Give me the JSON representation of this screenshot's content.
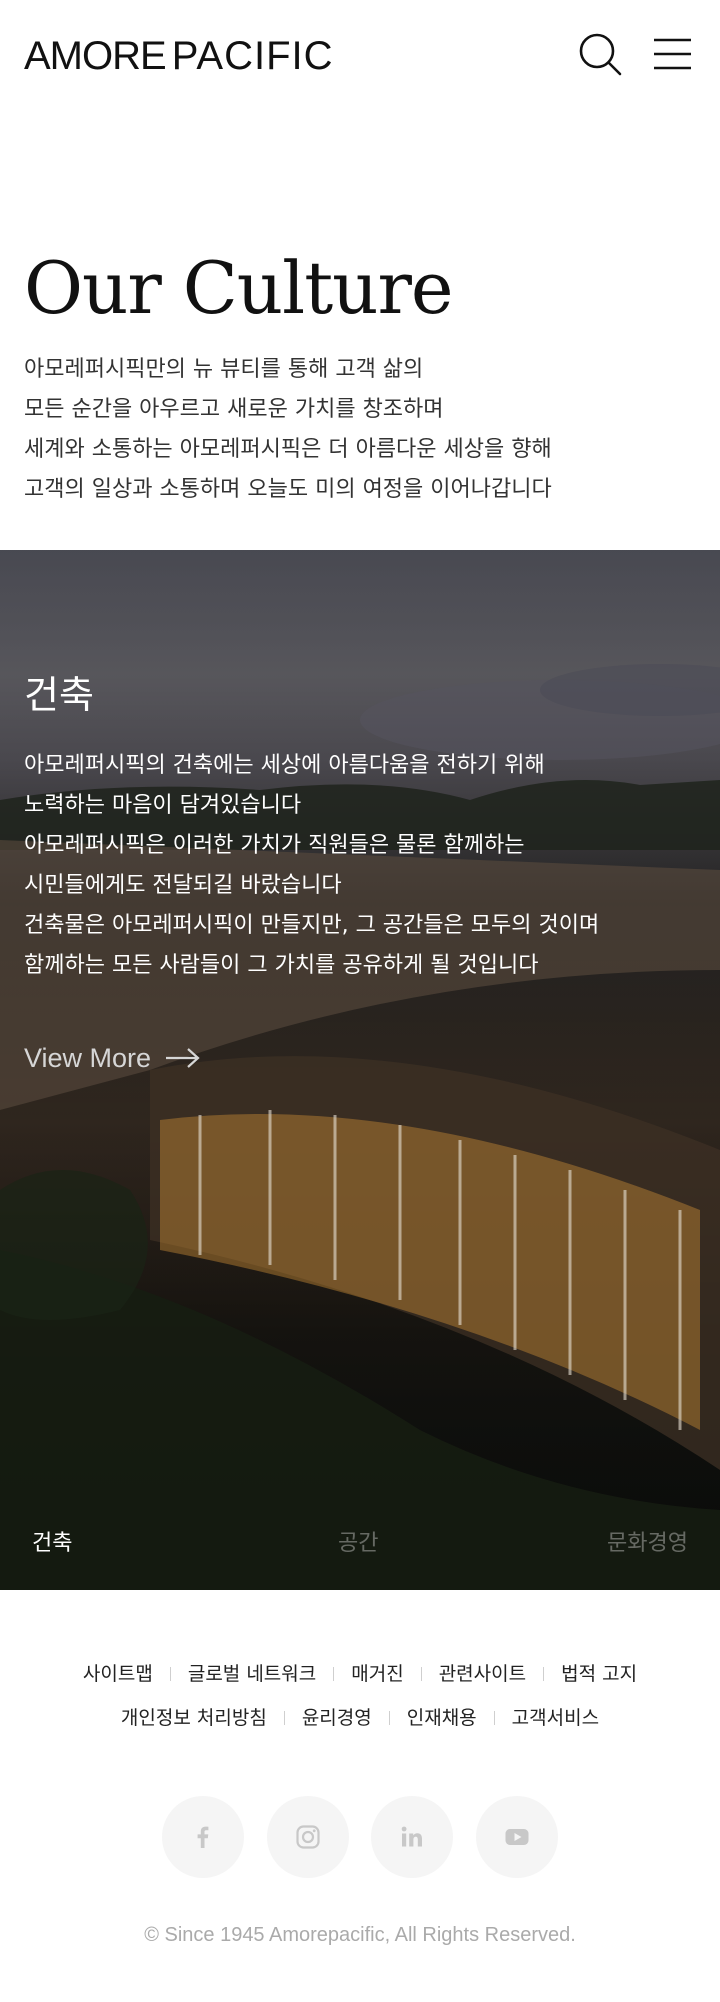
{
  "header": {
    "logo_part1": "AMORE",
    "logo_part2": "PACIFIC",
    "search_icon": "search-icon",
    "menu_icon": "hamburger-menu-icon"
  },
  "intro": {
    "title": "Our Culture",
    "lines": [
      "아모레퍼시픽만의 뉴 뷰티를 통해 고객 삶의",
      "모든 순간을 아우르고 새로운 가치를 창조하며",
      "세계와 소통하는 아모레퍼시픽은 더 아름다운 세상을 향해",
      "고객의 일상과 소통하며 오늘도 미의 여정을 이어나갑니다"
    ]
  },
  "feature": {
    "title": "건축",
    "lines": [
      "아모레퍼시픽의 건축에는 세상에 아름다움을 전하기 위해",
      "노력하는 마음이 담겨있습니다",
      "아모레퍼시픽은 이러한 가치가 직원들은 물론 함께하는",
      "시민들에게도 전달되길 바랐습니다",
      "건축물은 아모레퍼시픽이 만들지만, 그 공간들은 모두의 것이며",
      "함께하는 모든 사람들이 그 가치를 공유하게 될 것입니다"
    ],
    "view_more": "View More",
    "arrow_icon": "arrow-right-icon",
    "tabs": [
      {
        "label": "건축",
        "active": true
      },
      {
        "label": "공간",
        "active": false
      },
      {
        "label": "문화경영",
        "active": false
      }
    ]
  },
  "footer": {
    "row1": [
      "사이트맵",
      "글로벌 네트워크",
      "매거진",
      "관련사이트",
      "법적 고지"
    ],
    "row2": [
      "개인정보 처리방침",
      "윤리경영",
      "인재채용",
      "고객서비스"
    ],
    "socials": [
      "facebook-icon",
      "instagram-icon",
      "linkedin-icon",
      "youtube-icon"
    ],
    "copyright": "© Since 1945 Amorepacific, All Rights Reserved."
  },
  "colors": {
    "text_dark": "#111111",
    "footer_muted": "#aaaaaa",
    "social_bg": "#f5f5f5",
    "social_icon": "#c8c8c8"
  }
}
